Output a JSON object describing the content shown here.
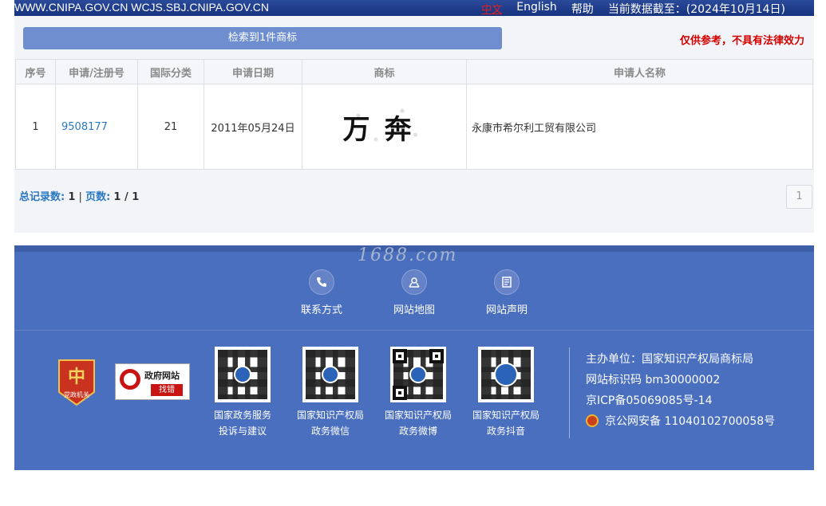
{
  "topbar": {
    "domains": "WWW.CNIPA.GOV.CN WCJS.SBJ.CNIPA.GOV.CN",
    "lang_cn": "中文",
    "lang_en": "English",
    "help": "帮助",
    "data_date": "当前数据截至：(2024年10月14日)"
  },
  "results": {
    "summary": "检索到1件商标",
    "disclaimer": "仅供参考，不具有法律效力",
    "headers": [
      "序号",
      "申请/注册号",
      "国际分类",
      "申请日期",
      "商标",
      "申请人名称"
    ],
    "rows": [
      {
        "index": "1",
        "reg_no": "9508177",
        "class": "21",
        "date": "2011年05月24日",
        "mark_text": "万奔",
        "applicant": "永康市希尔利工贸有限公司"
      }
    ],
    "total_label": "总记录数:",
    "total_value": "1",
    "sep": "|",
    "pages_label": "页数:",
    "pages_value": "1 / 1",
    "current_page": "1"
  },
  "footer": {
    "watermark": "1688.com",
    "links": [
      {
        "label": "联系方式",
        "icon": "phone-icon"
      },
      {
        "label": "网站地图",
        "icon": "map-pin-icon"
      },
      {
        "label": "网站声明",
        "icon": "document-icon"
      }
    ],
    "badge_text": "党政机关",
    "govfix_line1": "政府网站",
    "govfix_line2": "找错",
    "qrcodes": [
      {
        "line1": "国家政务服务",
        "line2": "投诉与建议"
      },
      {
        "line1": "国家知识产权局",
        "line2": "政务微信"
      },
      {
        "line1": "国家知识产权局",
        "line2": "政务微博"
      },
      {
        "line1": "国家知识产权局",
        "line2": "政务抖音"
      }
    ],
    "host": "主办单位：国家知识产权局商标局",
    "site_id": "网站标识码 bm30000002",
    "icp": "京ICP备05069085号-14",
    "police": "京公网安备 11040102700058号"
  },
  "colors": {
    "topbar": "#1e3a8a",
    "summary_bar": "#6e8ed0",
    "disclaimer": "#d40000",
    "link": "#2b78c2",
    "footer": "#4a6fbf"
  }
}
